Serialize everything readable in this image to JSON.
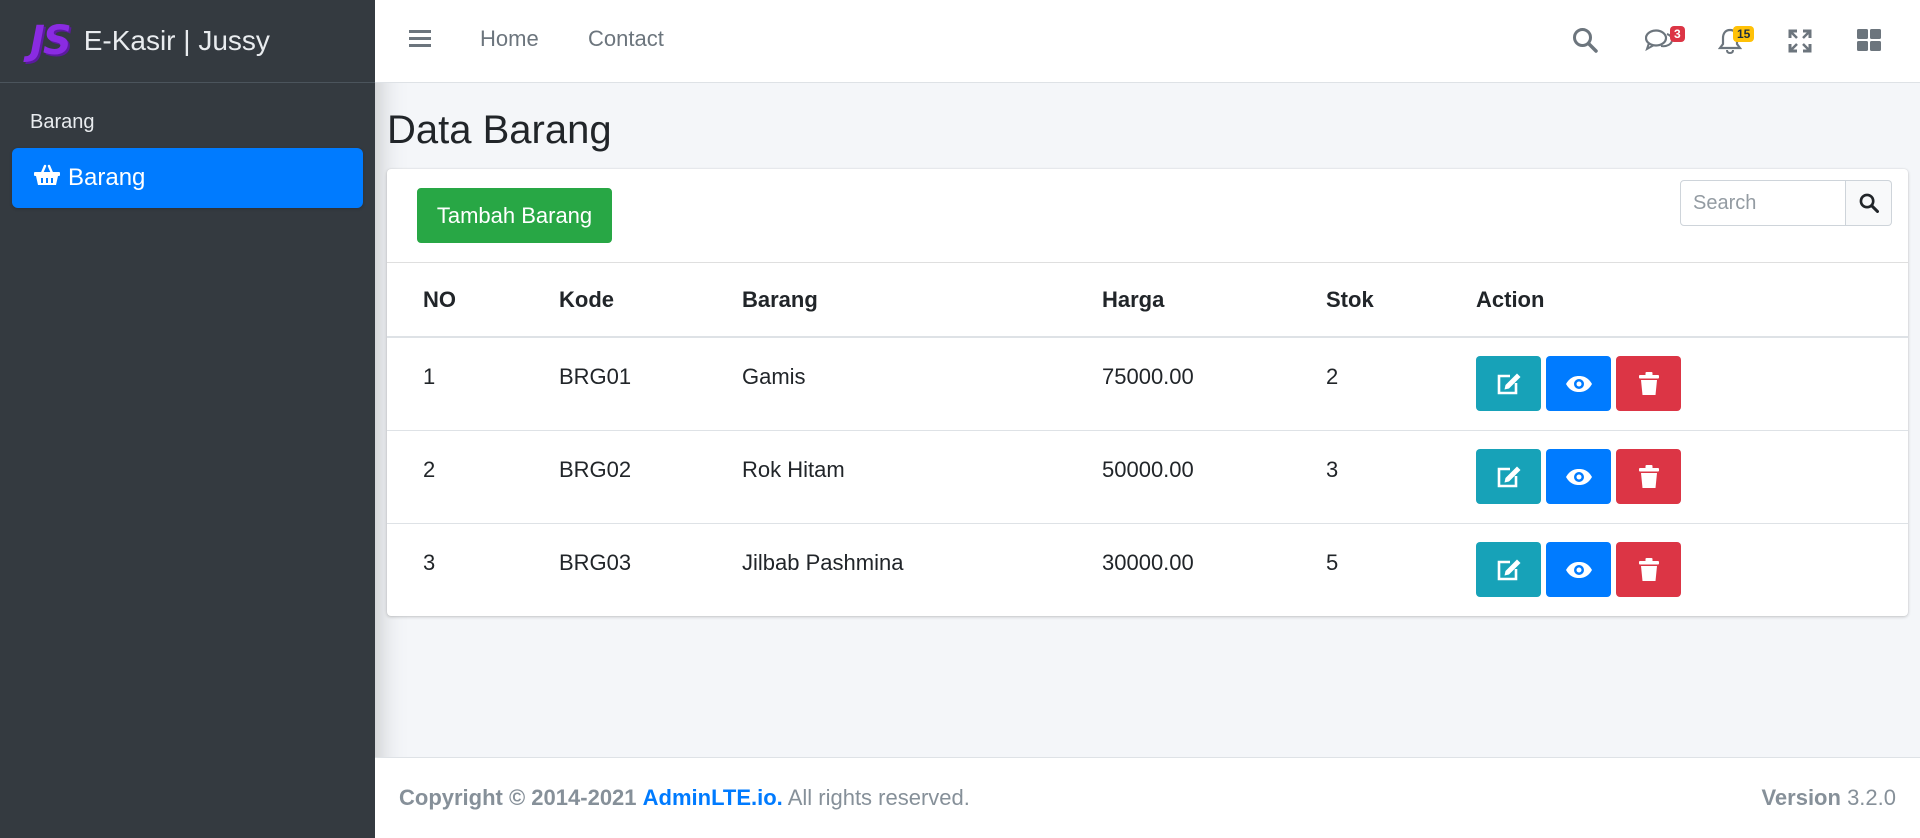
{
  "brand": {
    "logo": "JS",
    "name": "E-Kasir | Jussy"
  },
  "sidebar": {
    "header": "Barang",
    "items": [
      {
        "label": "Barang",
        "icon": "shopping-basket-icon",
        "active": true
      }
    ]
  },
  "topnav": {
    "links": [
      "Home",
      "Contact"
    ],
    "messages_badge": "3",
    "notifications_badge": "15"
  },
  "page": {
    "title": "Data Barang"
  },
  "card": {
    "add_button": "Tambah Barang",
    "search_placeholder": "Search"
  },
  "table": {
    "headers": [
      "NO",
      "Kode",
      "Barang",
      "Harga",
      "Stok",
      "Action"
    ],
    "rows": [
      {
        "no": "1",
        "kode": "BRG01",
        "barang": "Gamis",
        "harga": "75000.00",
        "stok": "2"
      },
      {
        "no": "2",
        "kode": "BRG02",
        "barang": "Rok Hitam",
        "harga": "50000.00",
        "stok": "3"
      },
      {
        "no": "3",
        "kode": "BRG03",
        "barang": "Jilbab Pashmina",
        "harga": "30000.00",
        "stok": "5"
      }
    ]
  },
  "footer": {
    "copyright": "Copyright © 2014-2021",
    "link": "AdminLTE.io.",
    "rights": "All rights reserved.",
    "version_label": "Version",
    "version": "3.2.0"
  },
  "colors": {
    "sidebar": "#343a40",
    "primary": "#007bff",
    "success": "#28a745",
    "info": "#17a2b8",
    "danger": "#dc3545",
    "warning": "#ffc107",
    "logo": "#8a2be2"
  }
}
